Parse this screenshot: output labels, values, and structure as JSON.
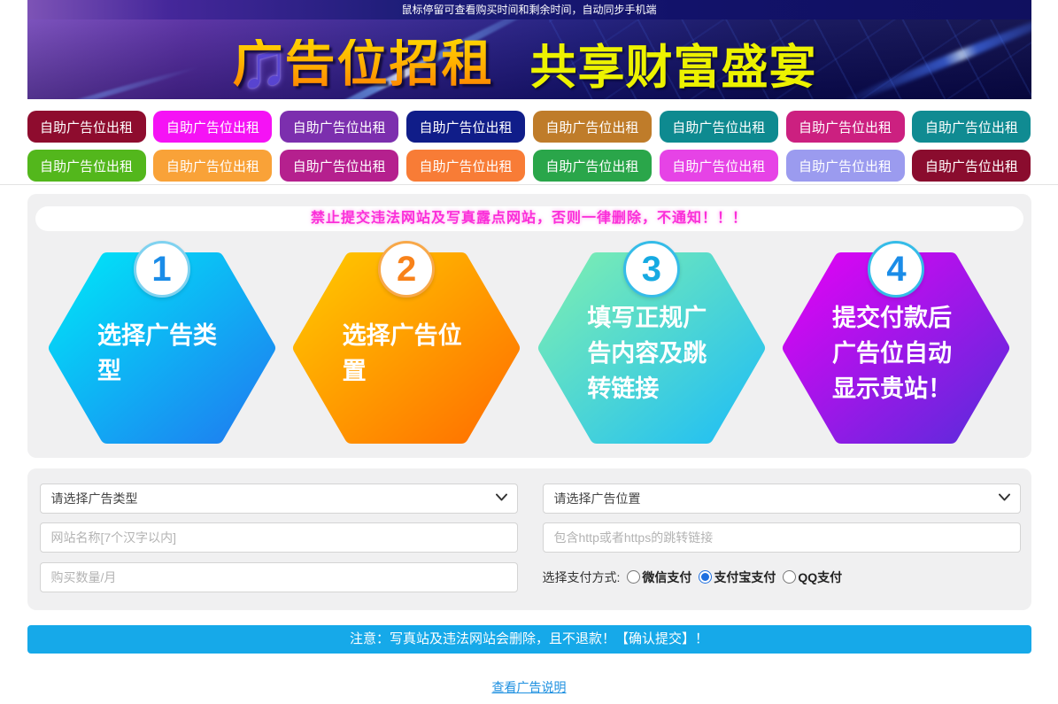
{
  "notice_bar": {
    "text": "鼠标停留可查看购买时间和剩余时间，自动同步手机端"
  },
  "banner": {
    "title": "广告位招租",
    "subtitle": "共享财富盛宴",
    "music_icon": "♫",
    "title_colors": [
      "#ffd400",
      "#ff8400"
    ],
    "subtitle_color": "#edf200"
  },
  "ad_buttons": {
    "label": "自助广告位出租",
    "rows": [
      [
        "#8e0c2e",
        "#f512f5",
        "#7c2fae",
        "#101d89",
        "#bf7c2a",
        "#0e8a90",
        "#cc2080",
        "#108b92"
      ],
      [
        "#53b71c",
        "#f9a238",
        "#b5208e",
        "#f87c36",
        "#2aa64a",
        "#e643e6",
        "#9b9bef",
        "#8a0c2e"
      ]
    ]
  },
  "warning": {
    "text": "禁止提交违法网站及写真露点网站，否则一律删除，不通知！！！",
    "color": "#fb2fd9"
  },
  "steps": [
    {
      "number": "1",
      "text": "选择广告类型",
      "gradient_start": "#00e6f8",
      "gradient_end": "#1f7bf0",
      "number_color": "#1a8ce8",
      "ring_color": "#7fd2f0"
    },
    {
      "number": "2",
      "text": "选择广告位置",
      "gradient_start": "#ffc800",
      "gradient_end": "#ff6f00",
      "number_color": "#f8821a",
      "ring_color": "#f8a849"
    },
    {
      "number": "3",
      "text": "填写正规广告内容及跳转链接",
      "gradient_start": "#7deeb2",
      "gradient_end": "#1fbef5",
      "number_color": "#16aae2",
      "ring_color": "#35bce8"
    },
    {
      "number": "4",
      "text": "提交付款后广告位自动显示贵站！",
      "gradient_start": "#e203f5",
      "gradient_end": "#5b2bdb",
      "number_color": "#1a8ce8",
      "ring_color": "#35bce8"
    }
  ],
  "form": {
    "type_select": {
      "value": "请选择广告类型"
    },
    "position_select": {
      "value": "请选择广告位置"
    },
    "site_name_input": {
      "placeholder": "网站名称[7个汉字以内]"
    },
    "link_input": {
      "placeholder": "包含http或者https的跳转链接"
    },
    "quantity_input": {
      "placeholder": "购买数量/月"
    },
    "payment": {
      "label": "选择支付方式:",
      "options": [
        {
          "label": "微信支付",
          "checked": false
        },
        {
          "label": "支付宝支付",
          "checked": true
        },
        {
          "label": "QQ支付",
          "checked": false
        }
      ],
      "radio_color": "#1d6fe0"
    }
  },
  "submit_bar": {
    "text": "注意：写真站及违法网站会删除，且不退款！【确认提交】！",
    "color": "#16a9e9"
  },
  "footer_link": {
    "text": "查看广告说明"
  }
}
